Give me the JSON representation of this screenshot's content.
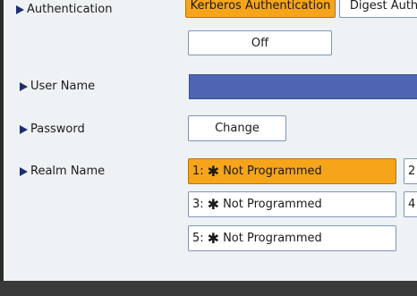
{
  "auth": {
    "label": "Authentication",
    "options": [
      "Kerberos Authentication",
      "Digest Auth"
    ],
    "off_label": "Off"
  },
  "user_name": {
    "label": "User Name"
  },
  "password": {
    "label": "Password",
    "button": "Change"
  },
  "realm": {
    "label": "Realm Name",
    "items": [
      {
        "num": "1:",
        "text": "Not Programmed",
        "next": "2"
      },
      {
        "num": "3:",
        "text": "Not Programmed",
        "next": "4"
      },
      {
        "num": "5:",
        "text": "Not Programmed"
      }
    ]
  },
  "colors": {
    "selected": "#f6a51a",
    "field": "#4d65b3"
  }
}
